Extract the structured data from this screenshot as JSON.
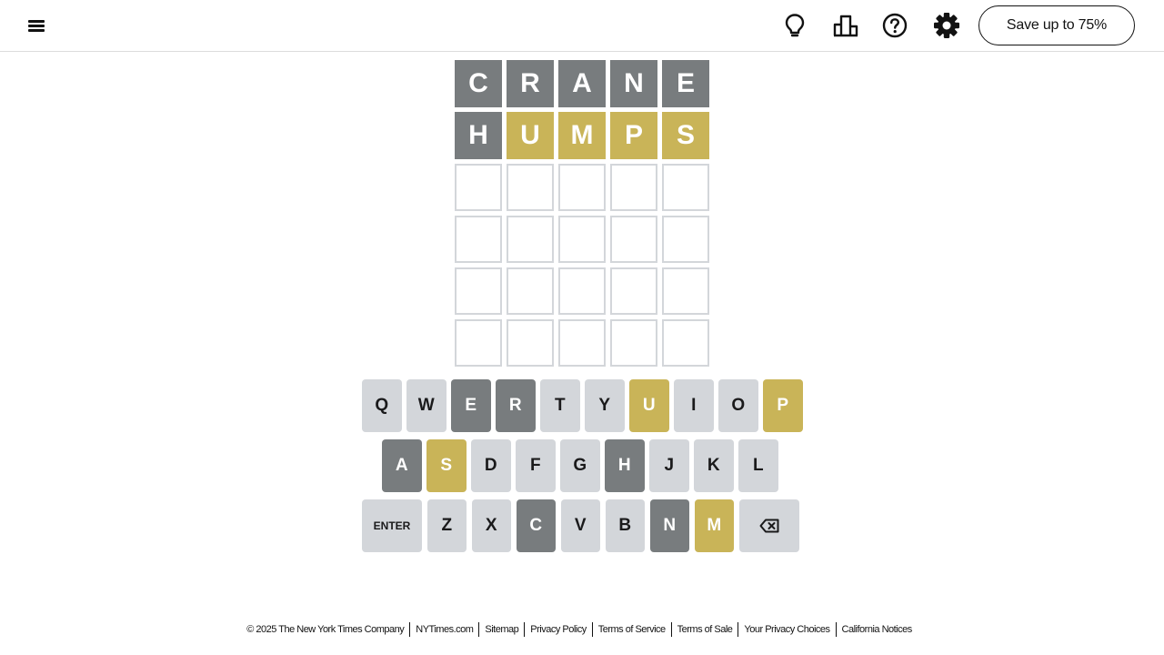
{
  "header": {
    "menu_icon": "hamburger-menu-icon",
    "hint_icon": "lightbulb-icon",
    "stats_icon": "leaderboard-icon",
    "help_icon": "question-circle-icon",
    "settings_icon": "gear-icon",
    "save_label": "Save up to 75%"
  },
  "board": {
    "rows": [
      [
        {
          "letter": "C",
          "state": "absent"
        },
        {
          "letter": "R",
          "state": "absent"
        },
        {
          "letter": "A",
          "state": "absent"
        },
        {
          "letter": "N",
          "state": "absent"
        },
        {
          "letter": "E",
          "state": "absent"
        }
      ],
      [
        {
          "letter": "H",
          "state": "absent"
        },
        {
          "letter": "U",
          "state": "present"
        },
        {
          "letter": "M",
          "state": "present"
        },
        {
          "letter": "P",
          "state": "present"
        },
        {
          "letter": "S",
          "state": "present"
        }
      ],
      [
        {
          "letter": "",
          "state": "empty"
        },
        {
          "letter": "",
          "state": "empty"
        },
        {
          "letter": "",
          "state": "empty"
        },
        {
          "letter": "",
          "state": "empty"
        },
        {
          "letter": "",
          "state": "empty"
        }
      ],
      [
        {
          "letter": "",
          "state": "empty"
        },
        {
          "letter": "",
          "state": "empty"
        },
        {
          "letter": "",
          "state": "empty"
        },
        {
          "letter": "",
          "state": "empty"
        },
        {
          "letter": "",
          "state": "empty"
        }
      ],
      [
        {
          "letter": "",
          "state": "empty"
        },
        {
          "letter": "",
          "state": "empty"
        },
        {
          "letter": "",
          "state": "empty"
        },
        {
          "letter": "",
          "state": "empty"
        },
        {
          "letter": "",
          "state": "empty"
        }
      ],
      [
        {
          "letter": "",
          "state": "empty"
        },
        {
          "letter": "",
          "state": "empty"
        },
        {
          "letter": "",
          "state": "empty"
        },
        {
          "letter": "",
          "state": "empty"
        },
        {
          "letter": "",
          "state": "empty"
        }
      ]
    ]
  },
  "keyboard": {
    "rows": [
      [
        {
          "key": "Q",
          "state": "unused"
        },
        {
          "key": "W",
          "state": "unused"
        },
        {
          "key": "E",
          "state": "absent"
        },
        {
          "key": "R",
          "state": "absent"
        },
        {
          "key": "T",
          "state": "unused"
        },
        {
          "key": "Y",
          "state": "unused"
        },
        {
          "key": "U",
          "state": "present"
        },
        {
          "key": "I",
          "state": "unused"
        },
        {
          "key": "O",
          "state": "unused"
        },
        {
          "key": "P",
          "state": "present"
        }
      ],
      [
        {
          "key": "A",
          "state": "absent"
        },
        {
          "key": "S",
          "state": "present"
        },
        {
          "key": "D",
          "state": "unused"
        },
        {
          "key": "F",
          "state": "unused"
        },
        {
          "key": "G",
          "state": "unused"
        },
        {
          "key": "H",
          "state": "absent"
        },
        {
          "key": "J",
          "state": "unused"
        },
        {
          "key": "K",
          "state": "unused"
        },
        {
          "key": "L",
          "state": "unused"
        }
      ],
      [
        {
          "key": "ENTER",
          "state": "unused"
        },
        {
          "key": "Z",
          "state": "unused"
        },
        {
          "key": "X",
          "state": "unused"
        },
        {
          "key": "C",
          "state": "absent"
        },
        {
          "key": "V",
          "state": "unused"
        },
        {
          "key": "B",
          "state": "unused"
        },
        {
          "key": "N",
          "state": "absent"
        },
        {
          "key": "M",
          "state": "present"
        },
        {
          "key": "backspace",
          "state": "unused"
        }
      ]
    ]
  },
  "colors": {
    "absent": "#787c7e",
    "present": "#c9b458",
    "unused_key": "#d3d6da",
    "empty_border": "#d3d6da"
  },
  "footer": {
    "copyright": "© 2025 The New York Times Company",
    "links": [
      "NYTimes.com",
      "Sitemap",
      "Privacy Policy",
      "Terms of Service",
      "Terms of Sale",
      "Your Privacy Choices",
      "California Notices"
    ]
  }
}
